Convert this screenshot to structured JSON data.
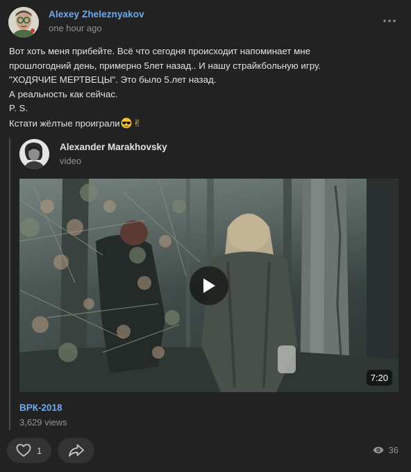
{
  "post": {
    "author": "Alexey Zheleznyakov",
    "time": "one hour ago",
    "more_icon": "more-horizontal-icon",
    "text_lines": [
      "Вот хоть меня прибейте. Всё что сегодня происходит напоминает мне",
      "прошлогодний день, примерно 5лет назад.. И нашу страйкбольную игру.",
      "\"ХОДЯЧИЕ МЕРТВЕЦЫ\". Это было 5.лет назад.",
      "А реальность как сейчас.",
      "P. S.",
      "Кстати жёлтые проиграли"
    ],
    "text_emoji": "✌"
  },
  "repost": {
    "author": "Alexander Marakhovsky",
    "subtitle": "video",
    "video": {
      "duration": "7:20",
      "title": "ВРК-2018",
      "views": "3,629 views"
    }
  },
  "footer": {
    "likes": "1",
    "views": "36",
    "like_icon": "heart-icon",
    "share_icon": "share-icon",
    "views_icon": "eye-icon"
  },
  "colors": {
    "background": "#222222",
    "link": "#71aaeb",
    "muted": "#939393",
    "button_bg": "#333333"
  }
}
